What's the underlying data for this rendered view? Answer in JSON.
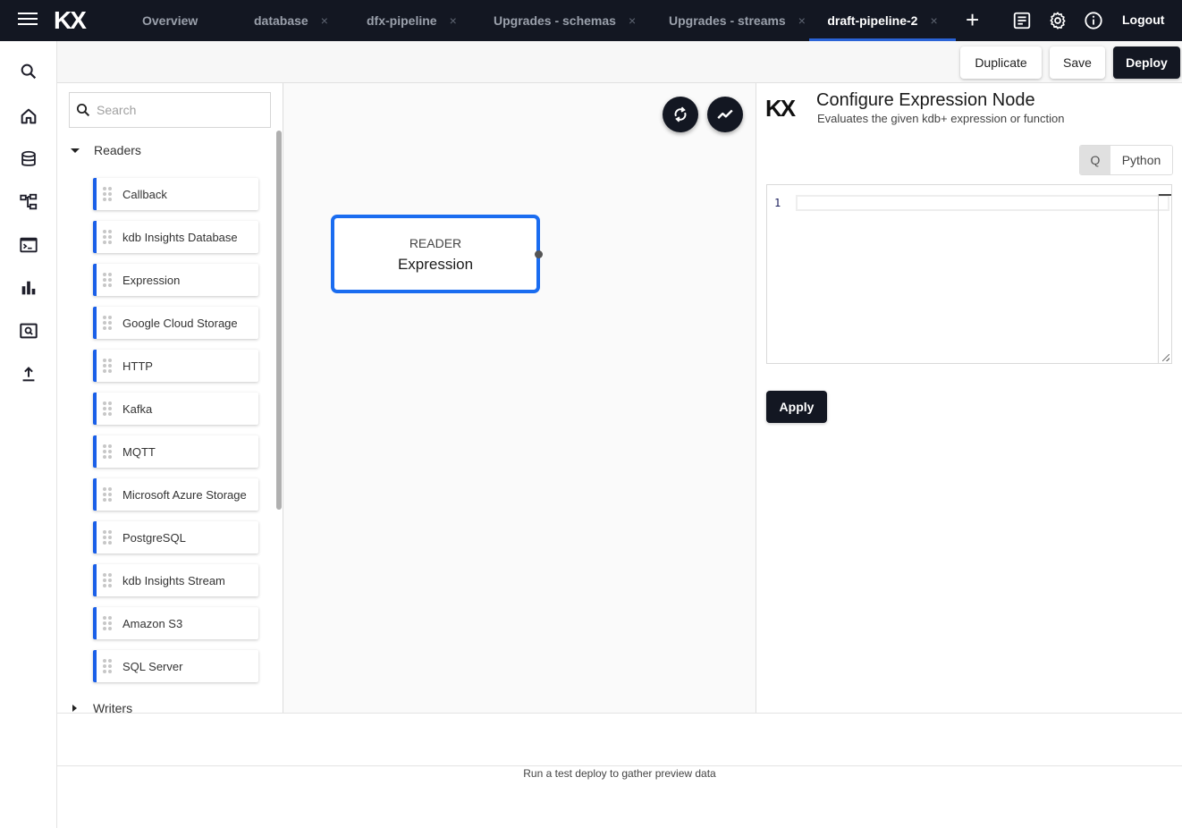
{
  "topbar": {
    "logo": "KX",
    "tabs": [
      {
        "label": "Overview",
        "closable": false,
        "active": false
      },
      {
        "label": "database",
        "closable": true,
        "active": false
      },
      {
        "label": "dfx-pipeline",
        "closable": true,
        "active": false
      },
      {
        "label": "Upgrades - schemas",
        "closable": true,
        "active": false
      },
      {
        "label": "Upgrades - streams",
        "closable": true,
        "active": false
      },
      {
        "label": "draft-pipeline-2",
        "closable": true,
        "active": true
      }
    ],
    "close_glyph": "×",
    "add_tab": "+",
    "icons": [
      "document-icon",
      "gear-icon",
      "info-icon"
    ],
    "logout_label": "Logout",
    "accent_color": "#2a63d6"
  },
  "rail": {
    "icons": [
      "search-icon",
      "home-icon",
      "database-icon",
      "pipeline-icon",
      "terminal-icon",
      "chart-icon",
      "query-icon",
      "upload-icon"
    ]
  },
  "actions": {
    "duplicate_label": "Duplicate",
    "save_label": "Save",
    "deploy_label": "Deploy"
  },
  "palette": {
    "search_placeholder": "Search",
    "groups": [
      {
        "label": "Readers",
        "expanded": true,
        "items": [
          "Callback",
          "kdb Insights Database",
          "Expression",
          "Google Cloud Storage",
          "HTTP",
          "Kafka",
          "MQTT",
          "Microsoft Azure Storage",
          "PostgreSQL",
          "kdb Insights Stream",
          "Amazon S3",
          "SQL Server"
        ]
      },
      {
        "label": "Writers",
        "expanded": false,
        "items": []
      }
    ],
    "item_accent": "#1a5fe8"
  },
  "canvas": {
    "buttons": [
      "refresh-icon",
      "trend-icon"
    ],
    "node": {
      "type": "READER",
      "name": "Expression",
      "border_color": "#1a6cf0"
    }
  },
  "config": {
    "logo": "KX",
    "title": "Configure Expression Node",
    "subtitle": "Evaluates the given kdb+ expression or function",
    "languages": [
      "Q",
      "Python"
    ],
    "selected_language": "Q",
    "editor": {
      "line_numbers": [
        "1"
      ],
      "content": ""
    },
    "apply_label": "Apply"
  },
  "preview": {
    "message": "Run a test deploy to gather preview data"
  }
}
